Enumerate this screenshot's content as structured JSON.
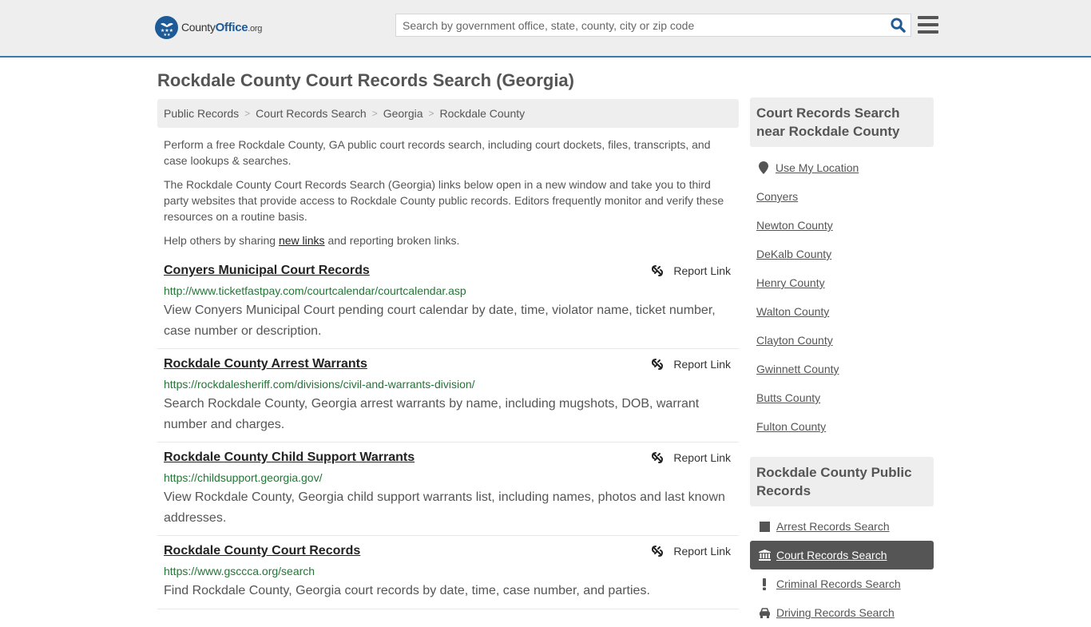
{
  "header": {
    "logo": {
      "county": "County",
      "office": "Office",
      "org": ".org"
    },
    "search_placeholder": "Search by government office, state, county, city or zip code",
    "search_value": ""
  },
  "page_title": "Rockdale County Court Records Search (Georgia)",
  "breadcrumb": [
    "Public Records",
    "Court Records Search",
    "Georgia",
    "Rockdale County"
  ],
  "intro": {
    "p1": "Perform a free Rockdale County, GA public court records search, including court dockets, files, transcripts, and case lookups & searches.",
    "p2": "The Rockdale County Court Records Search (Georgia) links below open in a new window and take you to third party websites that provide access to Rockdale County public records. Editors frequently monitor and verify these resources on a routine basis.",
    "p3_before": "Help others by sharing ",
    "p3_link": "new links",
    "p3_after": " and reporting broken links."
  },
  "report_label": "Report Link",
  "listings": [
    {
      "title": "Conyers Municipal Court Records",
      "url": "http://www.ticketfastpay.com/courtcalendar/courtcalendar.asp",
      "description": "View Conyers Municipal Court pending court calendar by date, time, violator name, ticket number, case number or description."
    },
    {
      "title": "Rockdale County Arrest Warrants",
      "url": "https://rockdalesheriff.com/divisions/civil-and-warrants-division/",
      "description": "Search Rockdale County, Georgia arrest warrants by name, including mugshots, DOB, warrant number and charges."
    },
    {
      "title": "Rockdale County Child Support Warrants",
      "url": "https://childsupport.georgia.gov/",
      "description": "View Rockdale County, Georgia child support warrants list, including names, photos and last known addresses."
    },
    {
      "title": "Rockdale County Court Records",
      "url": "https://www.gsccca.org/search",
      "description": "Find Rockdale County, Georgia court records by date, time, case number, and parties."
    }
  ],
  "sidebar": {
    "nearby_title": "Court Records Search near Rockdale County",
    "use_location": "Use My Location",
    "nearby": [
      "Conyers",
      "Newton County",
      "DeKalb County",
      "Henry County",
      "Walton County",
      "Clayton County",
      "Gwinnett County",
      "Butts County",
      "Fulton County"
    ],
    "public_records_title": "Rockdale County Public Records",
    "public_records": [
      {
        "label": "Arrest Records Search",
        "icon": "square-icon",
        "active": false
      },
      {
        "label": "Court Records Search",
        "icon": "courthouse-icon",
        "active": true
      },
      {
        "label": "Criminal Records Search",
        "icon": "exclamation-icon",
        "active": false
      },
      {
        "label": "Driving Records Search",
        "icon": "car-icon",
        "active": false
      }
    ]
  },
  "colors": {
    "accent_blue": "#1e5a96",
    "header_border": "#3b7bab",
    "url_green": "#237536",
    "active_item_bg": "#555555"
  }
}
